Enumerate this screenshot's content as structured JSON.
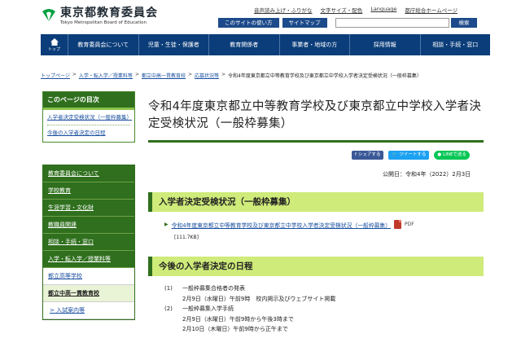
{
  "header": {
    "logo_title": "東京都教育委員会",
    "logo_sub": "Tokyo Metropolitan Board of Education",
    "toplinks": [
      "音声読み上げ・ふりがな",
      "文字サイズ・配色",
      "Language",
      "都庁総合ホームページ"
    ],
    "util_buttons": [
      "このサイトの使い方",
      "サイトマップ"
    ],
    "search_label": "検索"
  },
  "gnav": {
    "home_label": "トップ",
    "items": [
      "教育委員会について",
      "児童・生徒・保護者",
      "教育関係者",
      "事業者・地域の方",
      "採用情報",
      "相談・手続・窓口"
    ]
  },
  "breadcrumb": {
    "links": [
      "トップページ",
      "入学・転入学／授業料等",
      "都立中高一貫教育校",
      "応募状況等"
    ],
    "current": "令和4年度東京都立中等教育学校及び東京都立中学校入学者決定受検状況（一般枠募集）"
  },
  "toc": {
    "title": "このページの目次",
    "items": [
      "入学者決定受検状況（一般枠募集）",
      "今後の入学者決定の日程"
    ]
  },
  "menu": {
    "items": [
      {
        "label": "教育委員会について",
        "kind": "dark"
      },
      {
        "label": "学校教育",
        "kind": "dark"
      },
      {
        "label": "生涯学習・文化財",
        "kind": "dark"
      },
      {
        "label": "教職員関連",
        "kind": "dark"
      },
      {
        "label": "相談・手続・窓口",
        "kind": "dark"
      },
      {
        "label": "入学・転入学／授業料等",
        "kind": "dark"
      },
      {
        "label": "都立高等学校",
        "kind": "sub"
      },
      {
        "label": "都立中高一貫教育校",
        "kind": "cur"
      },
      {
        "label": "> 入試案内等",
        "kind": "sub2"
      }
    ]
  },
  "main": {
    "title": "令和4年度東京都立中等教育学校及び東京都立中学校入学者決定受検状況（一般枠募集）",
    "share": {
      "facebook": "シェアする",
      "twitter": "ツイートする",
      "line": "LINEで送る"
    },
    "published": "公開日：令和4年（2022）2月3日",
    "section1_title": "入学者決定受検状況（一般枠募集）",
    "file_link": "令和4年度東京都立中等教育学校及び東京都立中学校入学者決定受検状況（一般枠募集）",
    "file_type": "PDF",
    "file_size": "[111.7KB]",
    "section2_title": "今後の入学者決定の日程",
    "schedule": [
      {
        "num": "(1)",
        "text": "一般枠募集合格者の発表"
      },
      {
        "num": "",
        "text": "2月9日（水曜日）午前9時　校内掲示及びウェブサイト掲載"
      },
      {
        "num": "(2)",
        "text": "一般枠募集入学手続"
      },
      {
        "num": "",
        "text": "2月9日（水曜日）午前9時から午後3時まで"
      },
      {
        "num": "",
        "text": "2月10日（木曜日）午前9時から正午まで"
      }
    ]
  },
  "colors": {
    "navy": "#0b3d7a",
    "green": "#2f6f1d",
    "lime": "#cfeb7a",
    "link": "#1a4fa0"
  }
}
